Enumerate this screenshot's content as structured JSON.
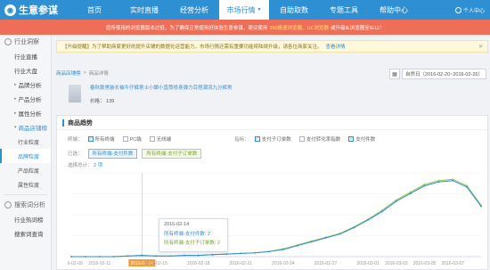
{
  "nav": {
    "logo": "生意参谋",
    "items": [
      "首页",
      "实时直播",
      "经营分析",
      "市场行情",
      "自助取数",
      "专题工具",
      "帮助中心"
    ],
    "active_index": 3,
    "user": "个人中心"
  },
  "banner": {
    "text_before": "您所使用的浏览器版本过低，为了确保正常使用好体验生意参谋，建议使用",
    "highlight": "360极速浏览器、UC浏览器",
    "text_after": "或升级IE浏览器至IE11！"
  },
  "sidebar": {
    "group1": "行业洞察",
    "group1_items": [
      "行业直播",
      "行业大盘"
    ],
    "sections": [
      "品牌分析",
      "产品分析",
      "属性分析",
      "商品店铺榜"
    ],
    "sub_items": [
      "行业粒度",
      "品牌粒度",
      "产品粒度",
      "属性粒度"
    ],
    "group2": "搜索词分析",
    "group2_items": [
      "行业热词榜",
      "搜索词查询"
    ]
  },
  "notice": {
    "text": "【升级提醒】为了帮助商家更好的提升店铺的数据化运营能力，市场行情还需有重要功能将陆续升级，请各位商家关注。",
    "link": "查看详情"
  },
  "breadcrumb": {
    "parent": "商品店铺榜",
    "current": "商品详情"
  },
  "date_range": "自然日（2016-02-20~2016-02-26）",
  "product": {
    "title_line1": "春秋款男装长袖牛仔裤男士小脚小直筒修身弹力百搭潮流九分裤男",
    "title_line2": "",
    "price_label": "价格：",
    "price": "139"
  },
  "trend": {
    "title": "商品趋势",
    "terminal_label": "终端：",
    "terminals": [
      "所有终端",
      "PC端",
      "无线端"
    ],
    "metric_label": "指标：",
    "metrics": [
      "支付子订单数",
      "支付转化率指数",
      "支付件数"
    ],
    "selected_label": "已选：",
    "selected_tags": [
      "所有终端-支付件数",
      "所有终端-支付子订单数"
    ],
    "selected_count_text": "选择总计：",
    "selected_count": "2 项"
  },
  "tooltip": {
    "date": "2016-02-14",
    "line1": "所有终端-支付件数: 2",
    "line2": "所有终端-支付子订单数: 2"
  },
  "chart_data": {
    "type": "line",
    "x": [
      "2016-02-09",
      "2016-02-10",
      "2016-02-11",
      "2016-02-12",
      "2016-02-13",
      "2016-02-14",
      "2016-02-15",
      "2016-02-16",
      "2016-02-17",
      "2016-02-18",
      "2016-02-19",
      "2016-02-20",
      "2016-02-21",
      "2016-02-22",
      "2016-02-23",
      "2016-02-24",
      "2016-02-25",
      "2016-02-26",
      "2016-02-27",
      "2016-02-28",
      "2016-02-29",
      "2016-03-01",
      "2016-03-02",
      "2016-03-03",
      "2016-03-04",
      "2016-03-05",
      "2016-03-06",
      "2016-03-07",
      "2016-03-08",
      "2016-03-09"
    ],
    "x_tick_labels": [
      "2016-02-09",
      "2016-02-11",
      "2016-02-14",
      "2016-02-15",
      "2016-02-18",
      "2016-02-21",
      "2016-02-24",
      "2016-02-27",
      "2016-03-01",
      "2016-03-03",
      "2016-03-05",
      "2016-03-07"
    ],
    "active_tick": "2016-02-14",
    "series": [
      {
        "name": "所有终端-支付件数",
        "color": "#8cc84b",
        "values": [
          0,
          0,
          0,
          0,
          1,
          2,
          1,
          1,
          2,
          2,
          3,
          4,
          5,
          6,
          8,
          12,
          18,
          24,
          30,
          36,
          46,
          58,
          72,
          88,
          100,
          112,
          118,
          120,
          110,
          80
        ]
      },
      {
        "name": "所有终端-支付子订单数",
        "color": "#2f8fd3",
        "values": [
          0,
          0,
          0,
          0,
          1,
          2,
          1,
          1,
          2,
          2,
          3,
          4,
          5,
          6,
          8,
          11,
          17,
          23,
          29,
          35,
          45,
          57,
          70,
          86,
          98,
          110,
          116,
          118,
          108,
          78
        ]
      }
    ],
    "ylim": [
      0,
      130
    ],
    "grid": true
  }
}
